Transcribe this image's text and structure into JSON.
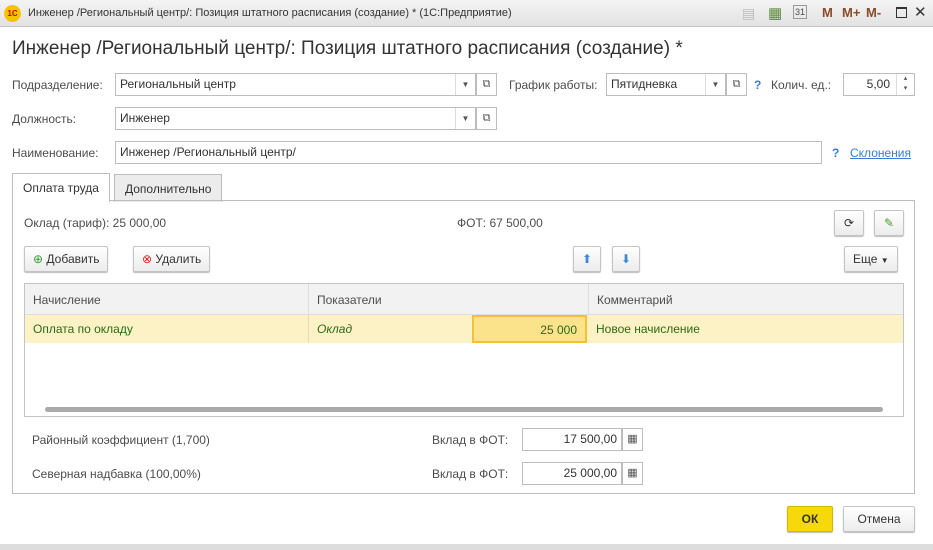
{
  "window": {
    "title": "Инженер /Региональный центр/: Позиция штатного расписания (создание) *  (1С:Предприятие)",
    "logo": "1С",
    "buttons": [
      "M",
      "M+",
      "M-"
    ]
  },
  "header": {
    "title": "Инженер /Региональный центр/: Позиция штатного расписания (создание) *"
  },
  "form": {
    "department_label": "Подразделение:",
    "department": "Региональный центр",
    "schedule_label": "График работы:",
    "schedule": "Пятидневка",
    "qty_label": "Колич. ед.:",
    "qty": "5,00",
    "position_label": "Должность:",
    "position": "Инженер",
    "name_label": "Наименование:",
    "name": "Инженер /Региональный центр/",
    "help": "?",
    "declension_link": "Склонения"
  },
  "tabs": [
    {
      "label": "Оплата труда"
    },
    {
      "label": "Дополнительно"
    }
  ],
  "pay": {
    "salary": "Оклад (тариф): 25 000,00",
    "fot": "ФОТ: 67 500,00",
    "add": "Добавить",
    "delete": "Удалить",
    "more": "Еще",
    "columns": [
      "Начисление",
      "Показатели",
      "Комментарий"
    ],
    "rows": [
      {
        "accrual": "Оплата по окладу",
        "indicator": "Оклад",
        "value": "25 000",
        "comment": "Новое начисление"
      }
    ],
    "regional_label": "Районный коэффициент (1,700)",
    "regional_contrib_label": "Вклад в ФОТ:",
    "regional_contrib": "17 500,00",
    "north_label": "Северная надбавка (100,00%)",
    "north_contrib_label": "Вклад в ФОТ:",
    "north_contrib": "25 000,00"
  },
  "footer": {
    "ok": "ОК",
    "cancel": "Отмена"
  }
}
